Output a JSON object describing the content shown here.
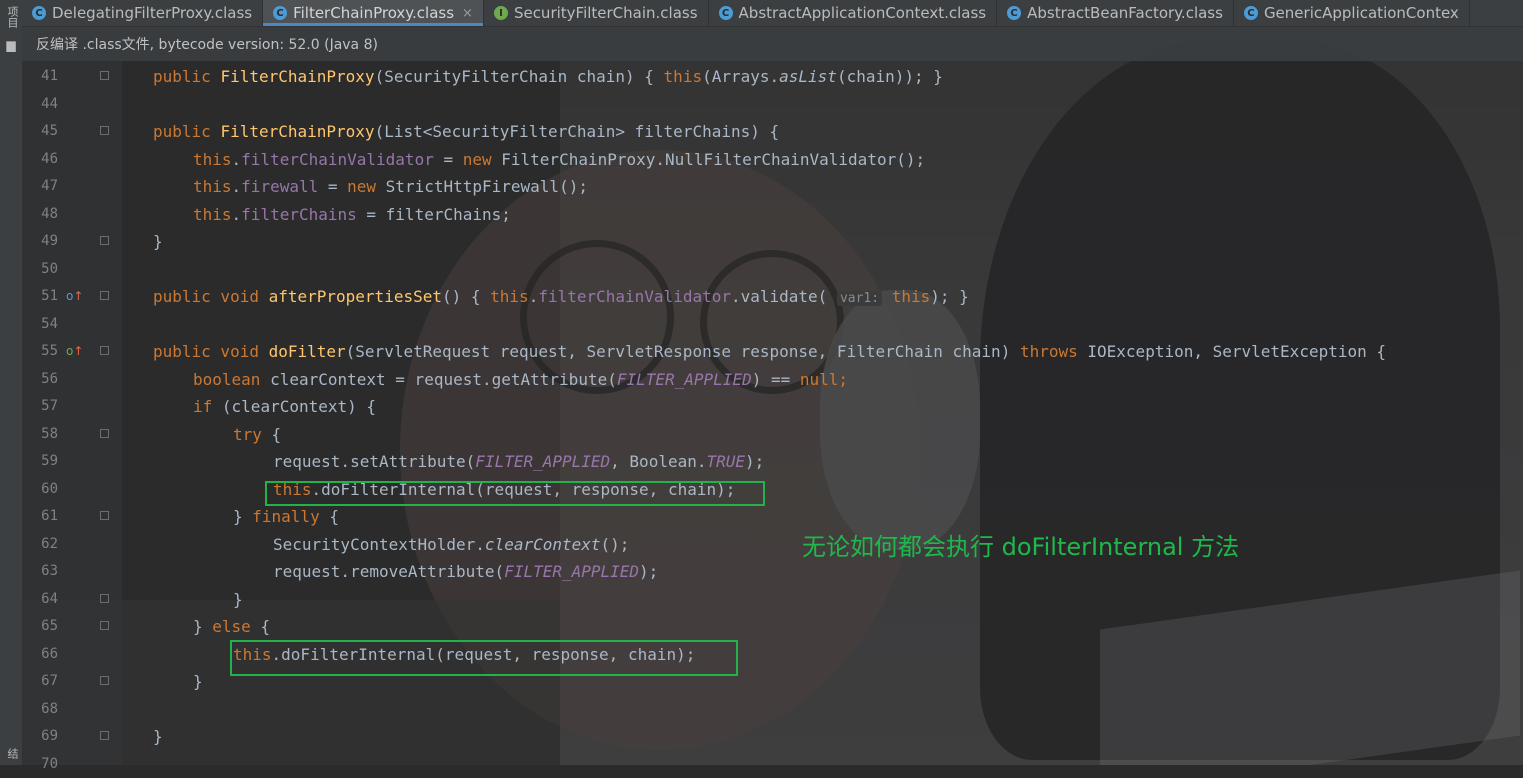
{
  "tabs": [
    {
      "label": "DelegatingFilterProxy.class",
      "icon": "class-icon",
      "active": false
    },
    {
      "label": "FilterChainProxy.class",
      "icon": "class-icon",
      "active": true,
      "close": "×"
    },
    {
      "label": "SecurityFilterChain.class",
      "icon": "interface-icon",
      "active": false
    },
    {
      "label": "AbstractApplicationContext.class",
      "icon": "class-icon",
      "active": false
    },
    {
      "label": "AbstractBeanFactory.class",
      "icon": "class-icon",
      "active": false
    },
    {
      "label": "GenericApplicationContex",
      "icon": "class-icon",
      "active": false
    }
  ],
  "tool_strip": {
    "project_label": "项目",
    "bottom_label": "结"
  },
  "notice": {
    "text": "反编译 .class文件, bytecode version: 52.0 (Java 8)"
  },
  "line_numbers": [
    "41",
    "44",
    "45",
    "46",
    "47",
    "48",
    "49",
    "50",
    "51",
    "54",
    "55",
    "56",
    "57",
    "58",
    "59",
    "60",
    "61",
    "62",
    "63",
    "64",
    "65",
    "66",
    "67",
    "68",
    "69",
    "70"
  ],
  "code": {
    "l41": {
      "a": "public ",
      "b": "FilterChainProxy",
      "c": "(SecurityFilterChain chain) { ",
      "d": "this",
      "e": "(Arrays.",
      "f": "asList",
      "g": "(chain)); }"
    },
    "l45": {
      "a": "public ",
      "b": "FilterChainProxy",
      "c": "(List<SecurityFilterChain> filterChains) {"
    },
    "l46": {
      "a": "this",
      "b": ".",
      "c": "filterChainValidator",
      "d": " = ",
      "e": "new ",
      "f": "FilterChainProxy.NullFilterChainValidator();"
    },
    "l47": {
      "a": "this",
      "b": ".",
      "c": "firewall",
      "d": " = ",
      "e": "new ",
      "f": "StrictHttpFirewall();"
    },
    "l48": {
      "a": "this",
      "b": ".",
      "c": "filterChains",
      "d": " = filterChains;"
    },
    "l49": {
      "a": "}"
    },
    "l51": {
      "a": "public void ",
      "b": "afterPropertiesSet",
      "c": "() { ",
      "d": "this",
      "e": ".",
      "f": "filterChainValidator",
      "g": ".validate( ",
      "h": "var1:",
      "i": " ",
      "j": "this",
      "k": "); }"
    },
    "l55": {
      "a": "public void ",
      "b": "doFilter",
      "c": "(ServletRequest request, ServletResponse response, FilterChain chain) ",
      "d": "throws ",
      "e": "IOException, ServletException {"
    },
    "l56": {
      "a": "boolean ",
      "b": "clearContext = request.getAttribute(",
      "c": "FILTER_APPLIED",
      "d": ") == ",
      "e": "null",
      "f": ";"
    },
    "l57": {
      "a": "if ",
      "b": "(clearContext) {"
    },
    "l58": {
      "a": "try ",
      "b": "{"
    },
    "l59": {
      "a": "request.setAttribute(",
      "b": "FILTER_APPLIED",
      "c": ", Boolean.",
      "d": "TRUE",
      "e": ");"
    },
    "l60": {
      "a": "this",
      "b": ".doFilterInternal(request, response, chain);"
    },
    "l61": {
      "a": "} ",
      "b": "finally ",
      "c": "{"
    },
    "l62": {
      "a": "SecurityContextHolder.",
      "b": "clearContext",
      "c": "();"
    },
    "l63": {
      "a": "request.removeAttribute(",
      "b": "FILTER_APPLIED",
      "c": ");"
    },
    "l64": {
      "a": "}"
    },
    "l65": {
      "a": "} ",
      "b": "else ",
      "c": "{"
    },
    "l66": {
      "a": "this",
      "b": ".doFilterInternal(request, response, chain);"
    },
    "l67": {
      "a": "}"
    },
    "l69": {
      "a": "}"
    }
  },
  "gutter_markers": {
    "l51": "o↑",
    "l55": "o↑"
  },
  "annotation": {
    "text": "无论如何都会执行 doFilterInternal 方法",
    "color": "#1fb84a"
  },
  "colors": {
    "keyword": "#cc7832",
    "method": "#ffc66d",
    "field": "#9876aa",
    "text": "#a9b7c6",
    "highlight": "#21b34a",
    "tab_underline": "#4a88c7"
  }
}
